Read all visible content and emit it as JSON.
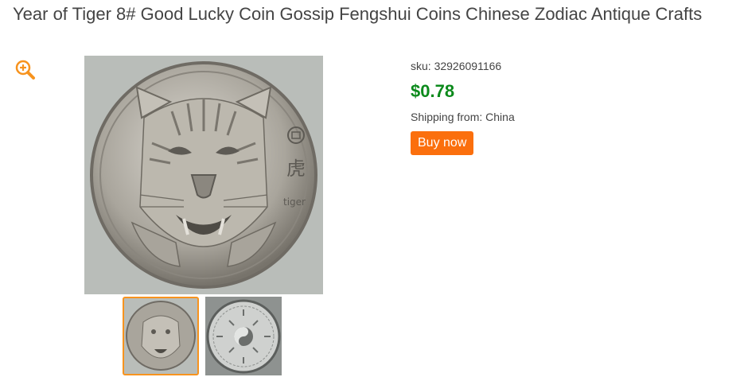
{
  "product": {
    "title": "Year of Tiger 8# Good Lucky Coin Gossip Fengshui Coins Chinese Zodiac Antique Crafts",
    "sku_text": "sku: 32926091166",
    "price": "$0.78",
    "shipping_text": "Shipping from: China",
    "buy_label": "Buy now"
  },
  "gallery": {
    "zoom_icon": "zoom-in-icon",
    "main_image": "tiger-coin-front",
    "coin_inscription_char": "虎",
    "coin_inscription_word": "tiger",
    "thumbnails": [
      {
        "name": "tiger-coin-front",
        "selected": true
      },
      {
        "name": "coin-back-yin-yang",
        "selected": false
      }
    ]
  },
  "colors": {
    "price": "#0c8a1c",
    "buy_button": "#fb6f0d",
    "selected_thumb_border": "#f7931e",
    "zoom_icon": "#f7931e"
  }
}
